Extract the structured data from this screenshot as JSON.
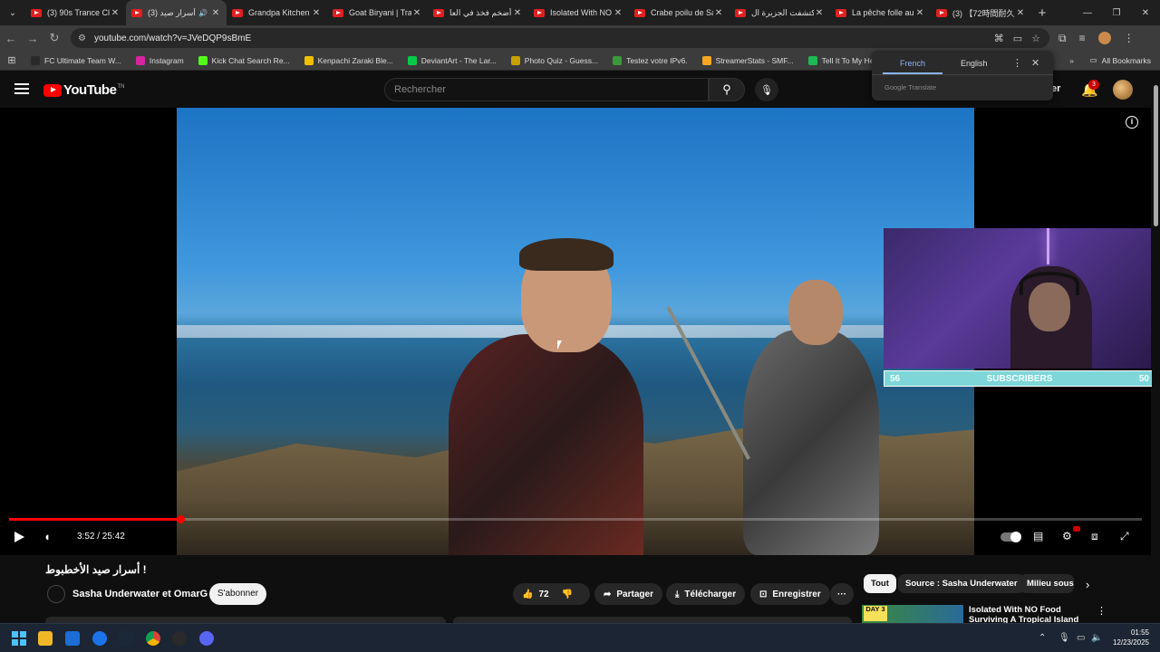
{
  "browser": {
    "tabs": [
      {
        "title": "(3) 90s Trance Clu",
        "active": false,
        "audio": false
      },
      {
        "title": "(3) أسرار صيد",
        "active": true,
        "audio": true
      },
      {
        "title": "Grandpa Kitchen",
        "active": false,
        "audio": false
      },
      {
        "title": "Goat Biryani | Trad",
        "active": false,
        "audio": false
      },
      {
        "title": "أضخم فخذ في العا",
        "active": false,
        "audio": false
      },
      {
        "title": "Isolated With NO",
        "active": false,
        "audio": false
      },
      {
        "title": "Crabe poilu de Sa",
        "active": false,
        "audio": false
      },
      {
        "title": "اكتشفت الجزيرة ال",
        "active": false,
        "audio": false
      },
      {
        "title": "La pêche folle au",
        "active": false,
        "audio": false
      },
      {
        "title": "(3) 【72時間耐久】",
        "active": false,
        "audio": false
      }
    ],
    "url": "youtube.com/watch?v=JVeDQP9sBmE",
    "bookmarks": [
      {
        "label": "FC Ultimate Team W...",
        "color": "#2a2a2a"
      },
      {
        "label": "Instagram",
        "color": "#d6249f"
      },
      {
        "label": "Kick Chat Search Re...",
        "color": "#53fc18"
      },
      {
        "label": "Kenpachi Zaraki Ble...",
        "color": "#f0c000"
      },
      {
        "label": "DeviantArt - The Lar...",
        "color": "#05cc47"
      },
      {
        "label": "Photo Quiz - Guess...",
        "color": "#c8a000"
      },
      {
        "label": "Testez votre IPv6.",
        "color": "#3a9a3a"
      },
      {
        "label": "StreamerStats - SMF...",
        "color": "#f5a623"
      },
      {
        "label": "Tell It To My Heart -...",
        "color": "#1db954"
      },
      {
        "label": "GlobalNet Sp",
        "color": "#cc2020"
      }
    ],
    "all_bookmarks": "All Bookmarks"
  },
  "translate_popup": {
    "tab_source": "French",
    "tab_target": "English",
    "footer": "Google Translate"
  },
  "youtube": {
    "logo_text": "YouTube",
    "logo_tm": "TN",
    "search_placeholder": "Rechercher",
    "header_partial": "er",
    "notifications_count": "3"
  },
  "player": {
    "current_time": "3:52",
    "duration": "25:42",
    "time_display": "3:52 / 25:42",
    "progress_fraction": 0.151,
    "overlay": {
      "left_count": "56",
      "label": "SUBSCRIBERS",
      "right_count": "50"
    }
  },
  "video_info": {
    "title": "أسرار صيد الأخطبوط !",
    "channel": "Sasha Underwater et OmarG",
    "subscribe_label": "S'abonner",
    "likes": "72",
    "share_label": "Partager",
    "download_label": "Télécharger",
    "save_label": "Enregistrer"
  },
  "recommendations": {
    "chips": [
      "Tout",
      "Source : Sasha Underwater",
      "Milieu sous"
    ],
    "first_title": "Isolated With NO Food Surviving A Tropical Island",
    "first_badge": "DAY 3"
  },
  "taskbar": {
    "time": "01:55",
    "date": "12/23/2025"
  },
  "colors": {
    "youtube_red": "#ff0000",
    "overlay_bar": "#7ed6d8",
    "translate_accent": "#8ab4f8"
  }
}
